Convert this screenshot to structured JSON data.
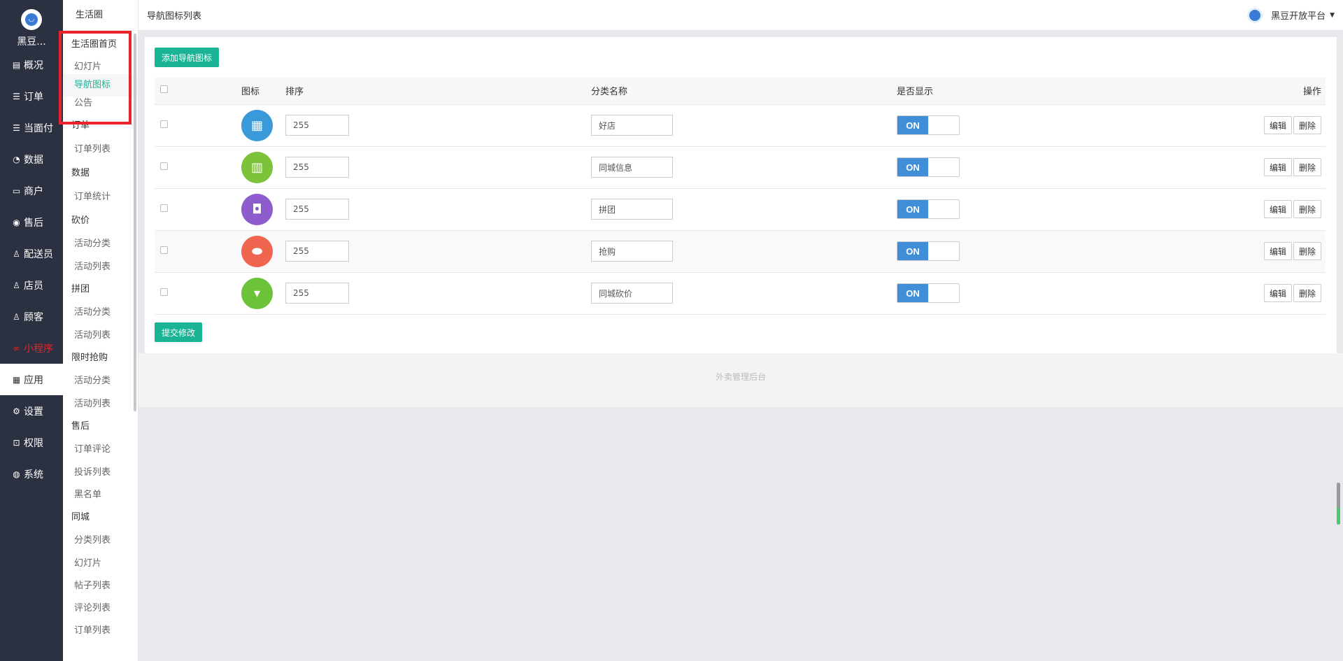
{
  "nav": {
    "brand_name": "黑豆...",
    "items": [
      {
        "icon": "layout-icon",
        "glyph": "▤",
        "label": "概况"
      },
      {
        "icon": "list-icon",
        "glyph": "☰",
        "label": "订单"
      },
      {
        "icon": "list-icon",
        "glyph": "☰",
        "label": "当面付"
      },
      {
        "icon": "chart-icon",
        "glyph": "◔",
        "label": "数据"
      },
      {
        "icon": "store-icon",
        "glyph": "▭",
        "label": "商户"
      },
      {
        "icon": "aftersale-icon",
        "glyph": "◉",
        "label": "售后"
      },
      {
        "icon": "user-icon",
        "glyph": "♙",
        "label": "配送员"
      },
      {
        "icon": "user-icon",
        "glyph": "♙",
        "label": "店员"
      },
      {
        "icon": "customer-icon",
        "glyph": "♙",
        "label": "顾客"
      },
      {
        "icon": "miniprogram-icon",
        "glyph": "∞",
        "label": "小程序"
      },
      {
        "icon": "apps-icon",
        "glyph": "▦",
        "label": "应用"
      },
      {
        "icon": "gear-icon",
        "glyph": "⚙",
        "label": "设置"
      },
      {
        "icon": "lock-icon",
        "glyph": "⊡",
        "label": "权限"
      },
      {
        "icon": "system-icon",
        "glyph": "◍",
        "label": "系统"
      }
    ]
  },
  "sub": {
    "title": "生活圈",
    "g0": "生活圈首页",
    "g0_l0": "幻灯片",
    "g0_l1": "导航图标",
    "g0_l2": "公告",
    "g1": "订单",
    "g1_l0": "订单列表",
    "g2": "数据",
    "g2_l0": "订单统计",
    "g3": "砍价",
    "g3_l0": "活动分类",
    "g3_l1": "活动列表",
    "g4": "拼团",
    "g4_l0": "活动分类",
    "g4_l1": "活动列表",
    "g5": "限时抢购",
    "g5_l0": "活动分类",
    "g5_l1": "活动列表",
    "g6": "售后",
    "g6_l0": "订单评论",
    "g6_l1": "投诉列表",
    "g6_l2": "黑名单",
    "g7": "同城",
    "g7_l0": "分类列表",
    "g7_l1": "幻灯片",
    "g7_l2": "帖子列表",
    "g7_l3": "评论列表",
    "g7_l4": "订单列表"
  },
  "header": {
    "title": "导航图标列表",
    "account": "黑豆开放平台"
  },
  "panel": {
    "add_label": "添加导航图标",
    "submit_label": "提交修改",
    "columns": {
      "icon": "图标",
      "sort": "排序",
      "name": "分类名称",
      "show": "是否显示",
      "ops": "操作"
    },
    "toggle_on": "ON",
    "edit_label": "编辑",
    "delete_label": "删除",
    "rows": [
      {
        "sort": "255",
        "name": "好店",
        "color": "#3a9ad9",
        "icon": "building-icon",
        "glyph": "▦",
        "shown": true
      },
      {
        "sort": "255",
        "name": "同城信息",
        "color": "#7cc23a",
        "icon": "book-icon",
        "glyph": "▥",
        "shown": true
      },
      {
        "sort": "255",
        "name": "拼团",
        "color": "#8e5ccd",
        "icon": "bag-icon",
        "glyph": "◘",
        "shown": true
      },
      {
        "sort": "255",
        "name": "抢购",
        "color": "#f06550",
        "icon": "ticket-icon",
        "glyph": "⬬",
        "shown": true
      },
      {
        "sort": "255",
        "name": "同城砍价",
        "color": "#6cc33a",
        "icon": "paint-roller-icon",
        "glyph": "▾",
        "shown": true
      }
    ]
  },
  "footer": "外卖管理后台"
}
